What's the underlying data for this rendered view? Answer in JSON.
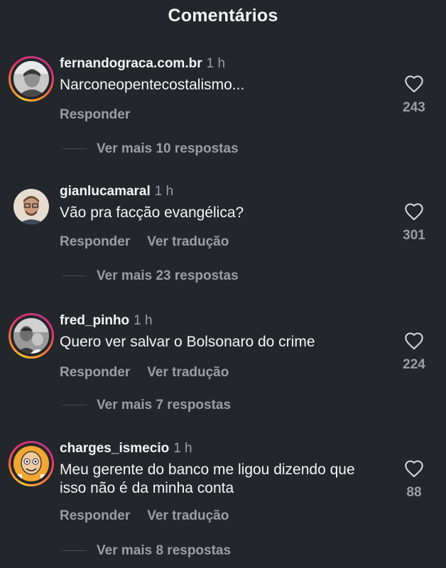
{
  "header": {
    "title": "Comentários"
  },
  "comments": [
    {
      "username": "fernandograca.com.br",
      "time": "1 h",
      "text": "Narconeopentecostalismo...",
      "reply_label": "Responder",
      "translate_label": "",
      "likes": "243",
      "more_replies": "Ver mais 10 respostas",
      "story_ring": true
    },
    {
      "username": "gianlucamaral",
      "time": "1 h",
      "text": "Vão pra facção evangélica?",
      "reply_label": "Responder",
      "translate_label": "Ver tradução",
      "likes": "301",
      "more_replies": "Ver mais 23 respostas",
      "story_ring": false
    },
    {
      "username": "fred_pinho",
      "time": "1 h",
      "text": "Quero ver salvar o Bolsonaro do crime",
      "reply_label": "Responder",
      "translate_label": "Ver tradução",
      "likes": "224",
      "more_replies": "Ver mais 7 respostas",
      "story_ring": true
    },
    {
      "username": "charges_ismecio",
      "time": "1 h",
      "text": "Meu gerente do banco me ligou dizendo que isso não é da minha conta",
      "reply_label": "Responder",
      "translate_label": "Ver tradução",
      "likes": "88",
      "more_replies": "Ver mais 8 respostas",
      "story_ring": true
    }
  ],
  "icons": {
    "like": "heart-outline-icon"
  },
  "colors": {
    "background": "#23262b",
    "primary_text": "#f5f5f7",
    "secondary_text": "#9c9ea4",
    "story_ring_gradient": [
      "#f9c22e",
      "#f77737",
      "#e1306c",
      "#c13584"
    ]
  }
}
